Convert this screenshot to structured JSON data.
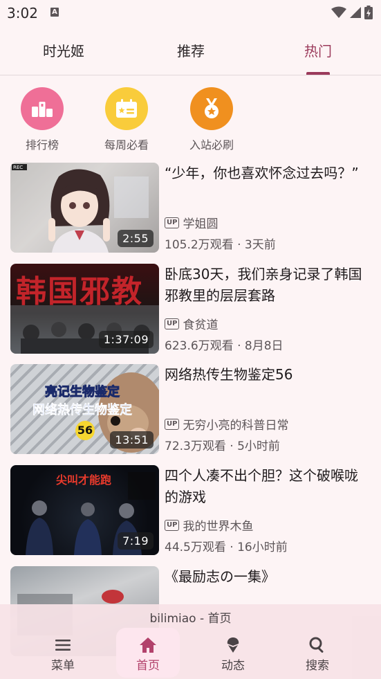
{
  "status": {
    "time": "3:02"
  },
  "tabs": [
    {
      "label": "时光姬"
    },
    {
      "label": "推荐"
    },
    {
      "label": "热门"
    }
  ],
  "active_tab": "热门",
  "shortcuts": [
    {
      "label": "排行榜",
      "icon": "ranking-icon",
      "color": "#ef6f97"
    },
    {
      "label": "每周必看",
      "icon": "calendar-star-icon",
      "color": "#f9cc3b"
    },
    {
      "label": "入站必刷",
      "icon": "medal-icon",
      "color": "#f0901f"
    }
  ],
  "videos": [
    {
      "title": "“少年，你也喜欢怀念过去吗？”",
      "up": "学姐圆",
      "meta": "105.2万观看 · 3天前",
      "duration": "2:55"
    },
    {
      "title": "卧底30天，我们亲身记录了韩国邪教里的层层套路",
      "up": "食贫道",
      "meta": "623.6万观看 · 8月8日",
      "duration": "1:37:09",
      "thumb_text": "韩国邪教"
    },
    {
      "title": "网络热传生物鉴定56",
      "up": "无穷小亮的科普日常",
      "meta": "72.3万观看 · 5小时前",
      "duration": "13:51",
      "thumb_text_1": "亮记生物鉴定",
      "thumb_text_2": "网络热传生物鉴定",
      "thumb_badge": "56"
    },
    {
      "title": "四个人凑不出个胆？这个破喉咙的游戏",
      "up": "我的世界木鱼",
      "meta": "44.5万观看 · 16小时前",
      "duration": "7:19",
      "thumb_text": "尖叫才能跑"
    },
    {
      "title": "《最励志の一集》"
    }
  ],
  "up_badge": "UP",
  "bottom_nav": {
    "caption": "bilimiao - 首页",
    "items": [
      {
        "label": "菜单",
        "icon": "menu-icon"
      },
      {
        "label": "首页",
        "icon": "home-icon"
      },
      {
        "label": "动态",
        "icon": "dynamic-icon"
      },
      {
        "label": "搜索",
        "icon": "search-icon"
      }
    ],
    "active": "首页"
  },
  "colors": {
    "accent": "#9b3a5b",
    "nav_active": "#b2416b",
    "background": "#fdf4f5"
  }
}
